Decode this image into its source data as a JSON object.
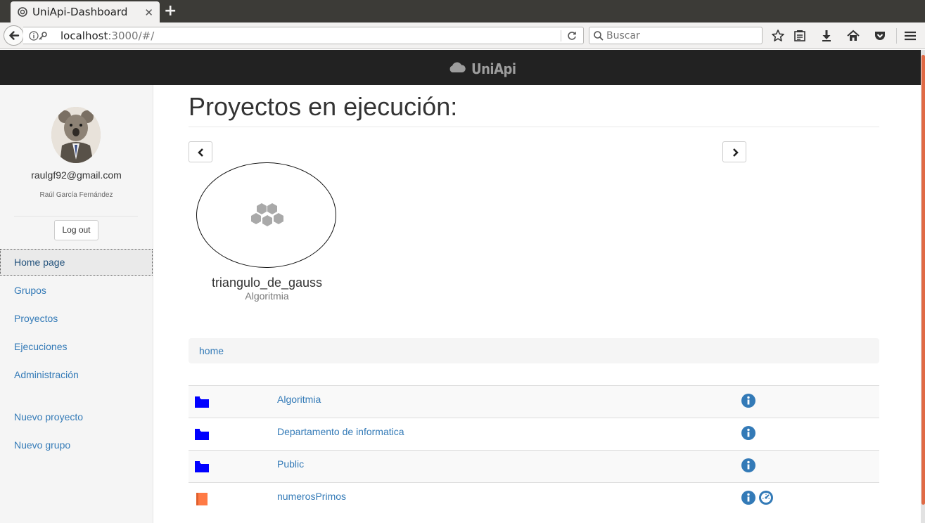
{
  "browser": {
    "tab_title": "UniApi-Dashboard",
    "url_host": "localhost",
    "url_rest": ":3000/#/",
    "search_placeholder": "Buscar"
  },
  "header": {
    "brand": "UniApi"
  },
  "user": {
    "email": "raulgf92@gmail.com",
    "name": "Raúl García Fernández",
    "logout_label": "Log out"
  },
  "sidebar": {
    "items": [
      {
        "label": "Home page"
      },
      {
        "label": "Grupos"
      },
      {
        "label": "Proyectos"
      },
      {
        "label": "Ejecuciones"
      },
      {
        "label": "Administración"
      },
      {
        "label": "Nuevo proyecto"
      },
      {
        "label": "Nuevo grupo"
      }
    ]
  },
  "main": {
    "title": "Proyectos en ejecución:",
    "running_project": {
      "name": "triangulo_de_gauss",
      "group": "Algoritmia"
    },
    "breadcrumb": "home",
    "rows": [
      {
        "name": "Algoritmia",
        "kind": "folder"
      },
      {
        "name": "Departamento de informatica",
        "kind": "folder"
      },
      {
        "name": "Public",
        "kind": "folder"
      },
      {
        "name": "numerosPrimos",
        "kind": "project"
      }
    ]
  },
  "colors": {
    "folder": "#0000ff",
    "project": "#ff7a45",
    "link": "#337ab7",
    "header": "#222222"
  }
}
